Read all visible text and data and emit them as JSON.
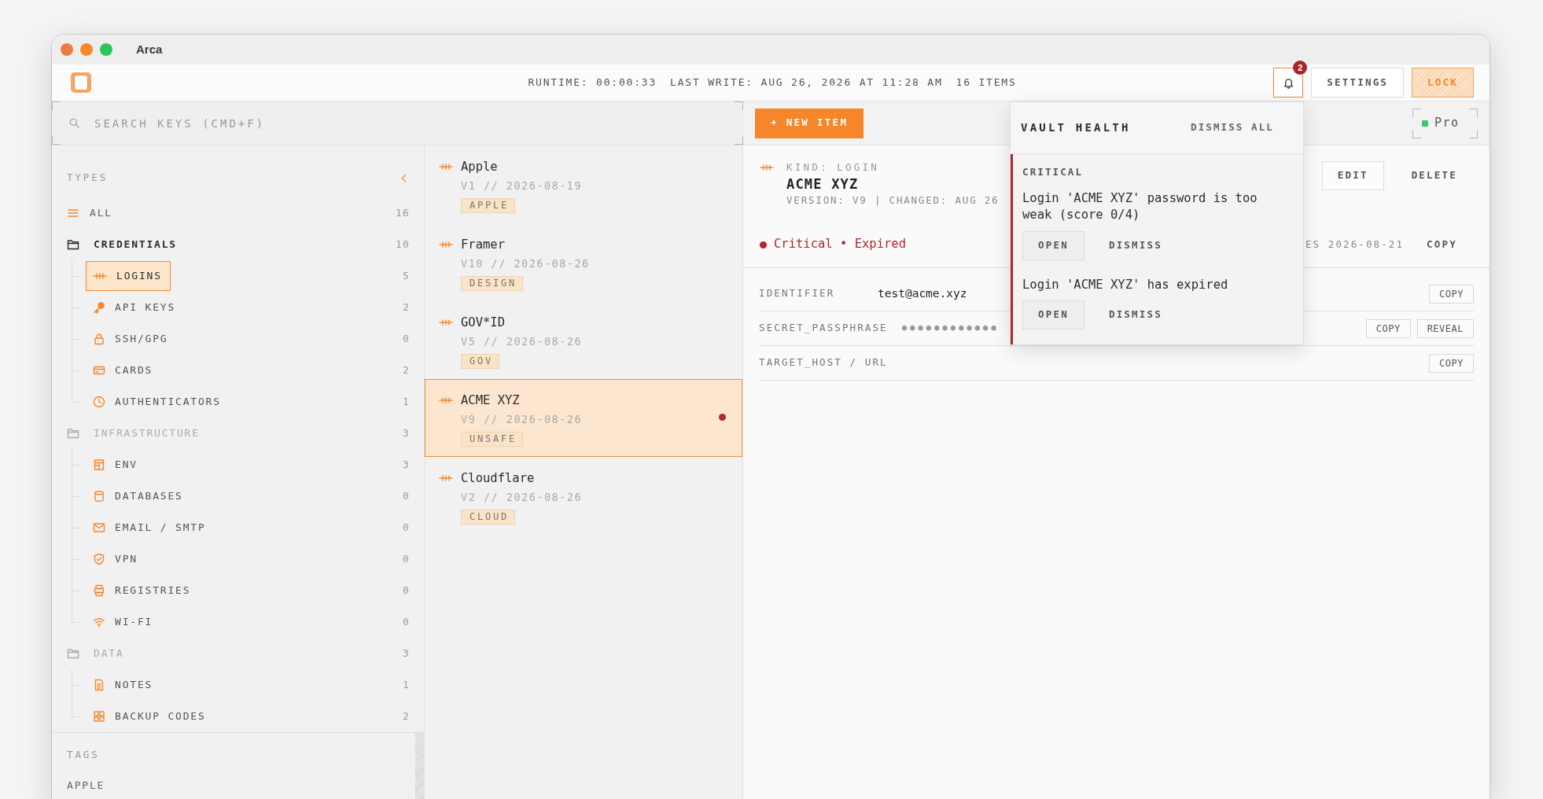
{
  "window": {
    "title": "Arca"
  },
  "header": {
    "status": [
      "RUNTIME: 00:00:33",
      "LAST WRITE: AUG 26, 2026 AT 11:28 AM",
      "16 ITEMS"
    ],
    "notifications": {
      "count": "2"
    },
    "buttons": [
      {
        "label": "SETTINGS",
        "kind": "settings"
      },
      {
        "label": "LOCK",
        "kind": "lock"
      }
    ]
  },
  "search": {
    "placeholder": "SEARCH KEYS (CMD+F)"
  },
  "toolbar": {
    "new_item": "+ NEW ITEM",
    "plan": "Pro"
  },
  "sidebar": {
    "heading": "TYPES",
    "items": [
      {
        "label": "ALL",
        "count": "16",
        "kind": "all",
        "selected": false
      },
      {
        "label": "CREDENTIALS",
        "count": "10",
        "kind": "group",
        "active": true,
        "selected": false,
        "children": [
          {
            "label": "LOGINS",
            "count": "5",
            "kind": "login",
            "selected": true
          },
          {
            "label": "API KEYS",
            "count": "2",
            "kind": "api_key",
            "selected": false
          },
          {
            "label": "SSH/GPG",
            "count": "0",
            "kind": "ssh",
            "selected": false
          },
          {
            "label": "CARDS",
            "count": "2",
            "kind": "card",
            "selected": false
          },
          {
            "label": "AUTHENTICATORS",
            "count": "1",
            "kind": "authenticator",
            "selected": false
          }
        ]
      },
      {
        "label": "INFRASTRUCTURE",
        "count": "3",
        "kind": "group",
        "active": false,
        "selected": false,
        "children": [
          {
            "label": "ENV",
            "count": "3",
            "kind": "env",
            "selected": false
          },
          {
            "label": "DATABASES",
            "count": "0",
            "kind": "database",
            "selected": false
          },
          {
            "label": "EMAIL / SMTP",
            "count": "0",
            "kind": "email",
            "selected": false
          },
          {
            "label": "VPN",
            "count": "0",
            "kind": "vpn",
            "selected": false
          },
          {
            "label": "REGISTRIES",
            "count": "0",
            "kind": "registry",
            "selected": false
          },
          {
            "label": "WI-FI",
            "count": "0",
            "kind": "wifi",
            "selected": false
          }
        ]
      },
      {
        "label": "DATA",
        "count": "3",
        "kind": "group",
        "active": false,
        "selected": false,
        "children": [
          {
            "label": "NOTES",
            "count": "1",
            "kind": "note",
            "selected": false
          },
          {
            "label": "BACKUP CODES",
            "count": "2",
            "kind": "backup",
            "selected": false
          }
        ]
      }
    ],
    "tags_heading": "TAGS",
    "tags": [
      "APPLE"
    ]
  },
  "list": {
    "items": [
      {
        "title": "Apple",
        "meta": "V1 // 2026-08-19",
        "tag": "APPLE",
        "kind": "login",
        "selected": false,
        "flagged": false
      },
      {
        "title": "Framer",
        "meta": "V10 // 2026-08-26",
        "tag": "DESIGN",
        "kind": "login",
        "selected": false,
        "flagged": false
      },
      {
        "title": "GOV*ID",
        "meta": "V5 // 2026-08-26",
        "tag": "GOV",
        "kind": "login",
        "selected": false,
        "flagged": false
      },
      {
        "title": "ACME XYZ",
        "meta": "V9 // 2026-08-26",
        "tag": "UNSAFE",
        "kind": "login",
        "selected": true,
        "flagged": true
      },
      {
        "title": "Cloudflare",
        "meta": "V2 // 2026-08-26",
        "tag": "CLOUD",
        "kind": "login",
        "selected": false,
        "flagged": false
      }
    ]
  },
  "detail": {
    "kind": "login",
    "kind_label": "KIND: LOGIN",
    "title": "ACME XYZ",
    "meta": "VERSION: V9 | CHANGED: AUG 26",
    "actions": [
      {
        "label": "EDIT",
        "kind": "outline"
      },
      {
        "label": "DELETE",
        "kind": "text"
      }
    ],
    "status": "Critical • Expired",
    "expiry": "ES 2026-08-21",
    "expiry_action": "COPY",
    "fields": [
      {
        "label": "IDENTIFIER",
        "value": "test@acme.xyz",
        "kind": "text",
        "actions": [
          "COPY"
        ]
      },
      {
        "label": "SECRET_PASSPHRASE",
        "value": "●●●●●●●●●●●●",
        "kind": "secret",
        "actions": [
          "COPY",
          "REVEAL"
        ]
      },
      {
        "label": "TARGET_HOST / URL",
        "actions": [
          "COPY"
        ]
      }
    ]
  },
  "popover": {
    "title": "VAULT HEALTH",
    "dismiss_all": "DISMISS ALL",
    "severity": "CRITICAL",
    "alerts": [
      {
        "message": "Login 'ACME XYZ' password is too weak (score 0/4)",
        "actions": [
          {
            "label": "OPEN",
            "kind": "outline"
          },
          {
            "label": "DISMISS",
            "kind": "text"
          }
        ]
      },
      {
        "message": "Login 'ACME XYZ' has expired",
        "actions": [
          {
            "label": "OPEN",
            "kind": "outline"
          },
          {
            "label": "DISMISS",
            "kind": "text"
          }
        ]
      }
    ]
  }
}
